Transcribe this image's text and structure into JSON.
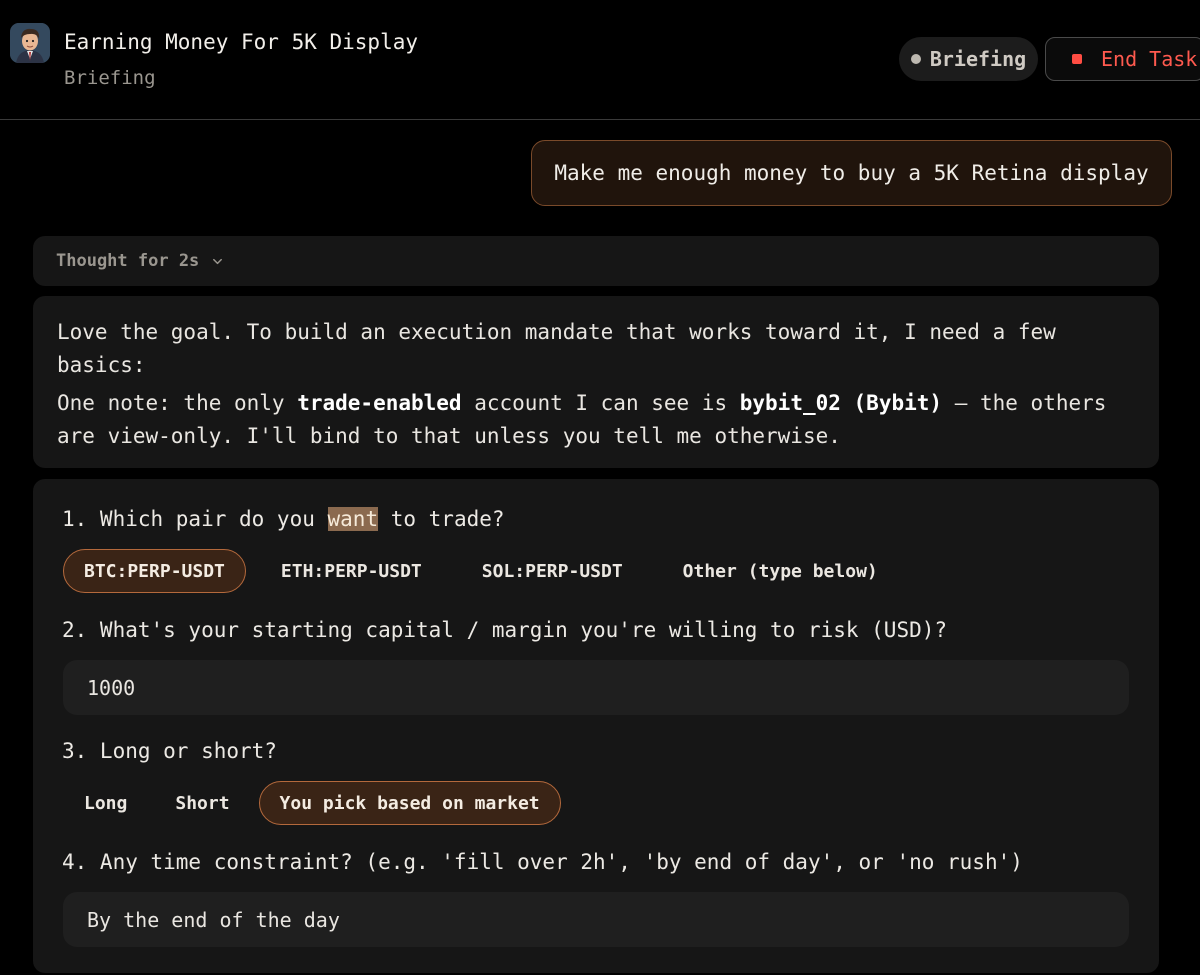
{
  "header": {
    "task_title": "Earning Money For 5K Display",
    "task_subtitle": "Briefing",
    "status_label": "Briefing",
    "end_task_label": "End Task"
  },
  "conversation": {
    "user_message": "Make me enough money to buy a 5K Retina display",
    "thought_label": "Thought for 2s",
    "reply": {
      "line1": "Love the goal. To build an execution mandate that works toward it, I need a few basics:",
      "line2_a": "One note: the only ",
      "line2_b": "trade-enabled",
      "line2_c": " account I can see is ",
      "line2_d": "bybit_02 (Bybit)",
      "line2_e": " — the others are view-only. I'll bind to that unless you tell me otherwise."
    }
  },
  "form": {
    "q1_pre": "1. Which pair do you ",
    "q1_hl": "want",
    "q1_post": " to trade?",
    "pair_options": [
      "BTC:PERP-USDT",
      "ETH:PERP-USDT",
      "SOL:PERP-USDT",
      "Other (type below)"
    ],
    "pair_selected": "BTC:PERP-USDT",
    "q2": "2. What's your starting capital / margin you're willing to risk (USD)?",
    "capital_value": "1000",
    "q3": "3. Long or short?",
    "direction_options": [
      "Long",
      "Short",
      "You pick based on market"
    ],
    "direction_selected": "You pick based on market",
    "q4": "4. Any time constraint? (e.g. 'fill over 2h', 'by end of day', or 'no rush')",
    "time_value": "By the end of the day"
  },
  "colors": {
    "accent_border": "#b4693c",
    "danger": "#ff5a4f",
    "panel": "#161616"
  }
}
